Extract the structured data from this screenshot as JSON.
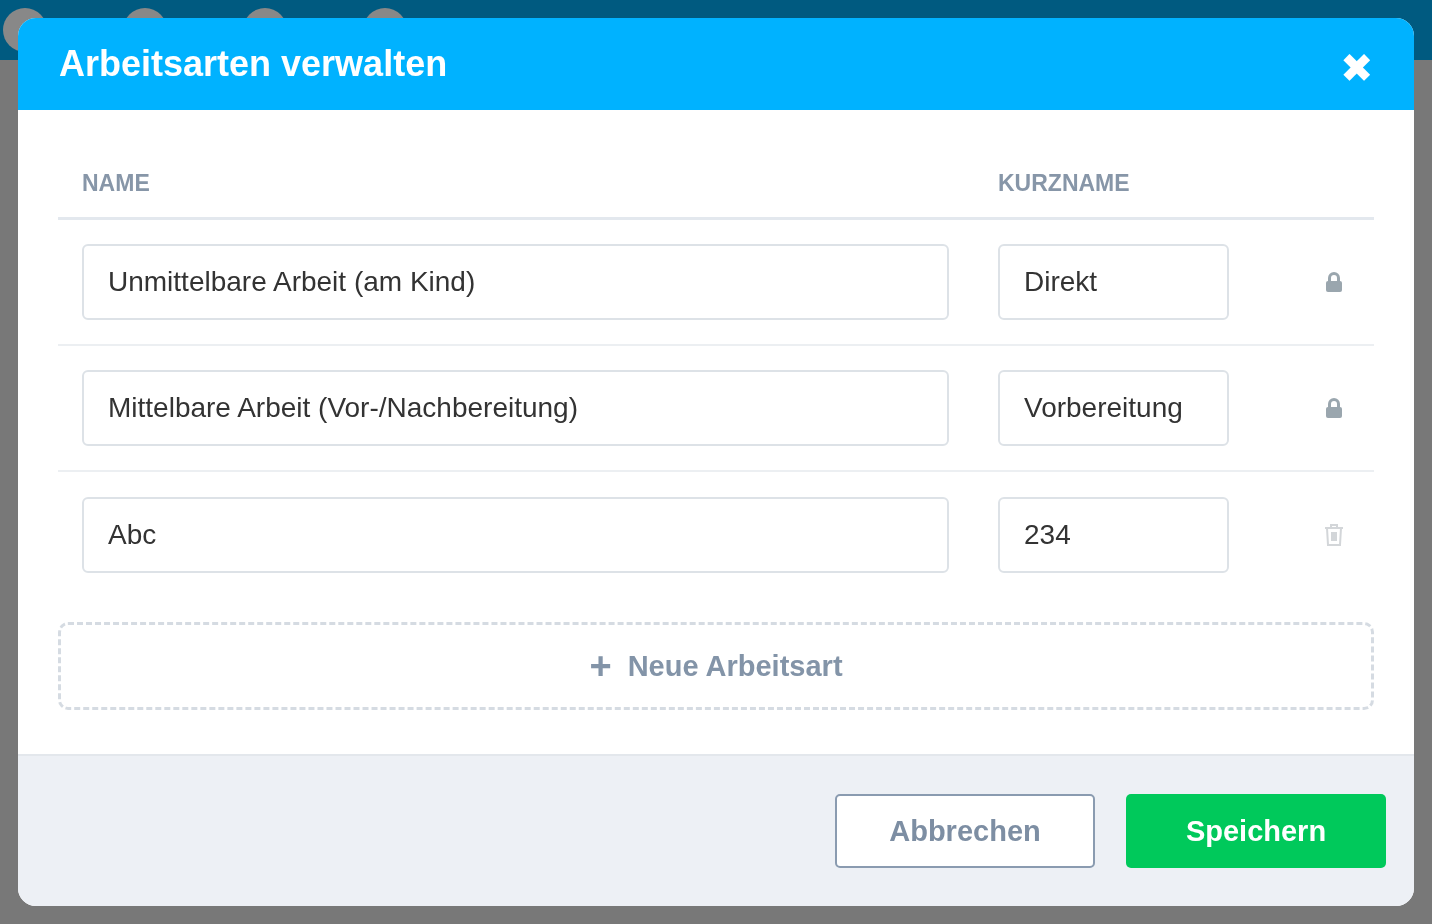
{
  "dialog": {
    "title": "Arbeitsarten verwalten",
    "close": "✖"
  },
  "table": {
    "columns": [
      "NAME",
      "KURZNAME"
    ],
    "rows": [
      {
        "name": "Unmittelbare Arbeit (am Kind)",
        "short": "Direkt",
        "kind": "locked"
      },
      {
        "name": "Mittelbare Arbeit (Vor-/Nachbereitung)",
        "short": "Vorbereitung",
        "kind": "locked"
      },
      {
        "name": "Abc",
        "short": "234",
        "kind": "deletable"
      }
    ]
  },
  "add_button": {
    "icon": "+",
    "label": "Neue Arbeitsart"
  },
  "buttons": [
    {
      "label": "Abbrechen",
      "kind": "secondary"
    },
    {
      "label": "Speichern",
      "kind": "primary"
    }
  ]
}
